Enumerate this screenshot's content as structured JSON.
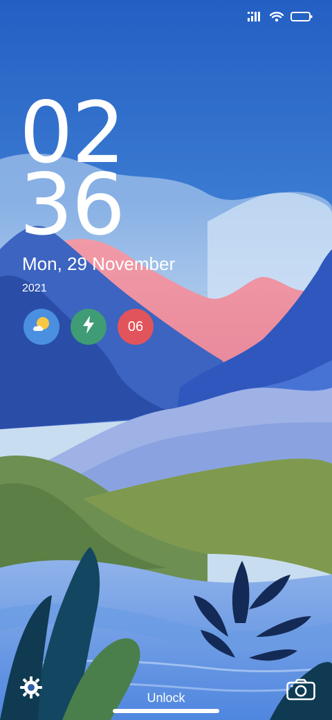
{
  "status_bar": {
    "signal_icon": "signal-icon",
    "wifi_icon": "wifi-icon",
    "battery_icon": "battery-icon"
  },
  "clock": {
    "hour": "02",
    "minute": "36"
  },
  "date": {
    "day_line": "Mon, 29 November",
    "year": "2021"
  },
  "widgets": [
    {
      "icon": "weather-icon",
      "color": "#4a8fe0"
    },
    {
      "icon": "charging-icon",
      "color": "#3f9c74"
    },
    {
      "label": "06",
      "color": "#e2545b"
    }
  ],
  "bottom_bar": {
    "unlock_label": "Unlock",
    "left_icon": "settings-icon",
    "right_icon": "camera-icon"
  }
}
